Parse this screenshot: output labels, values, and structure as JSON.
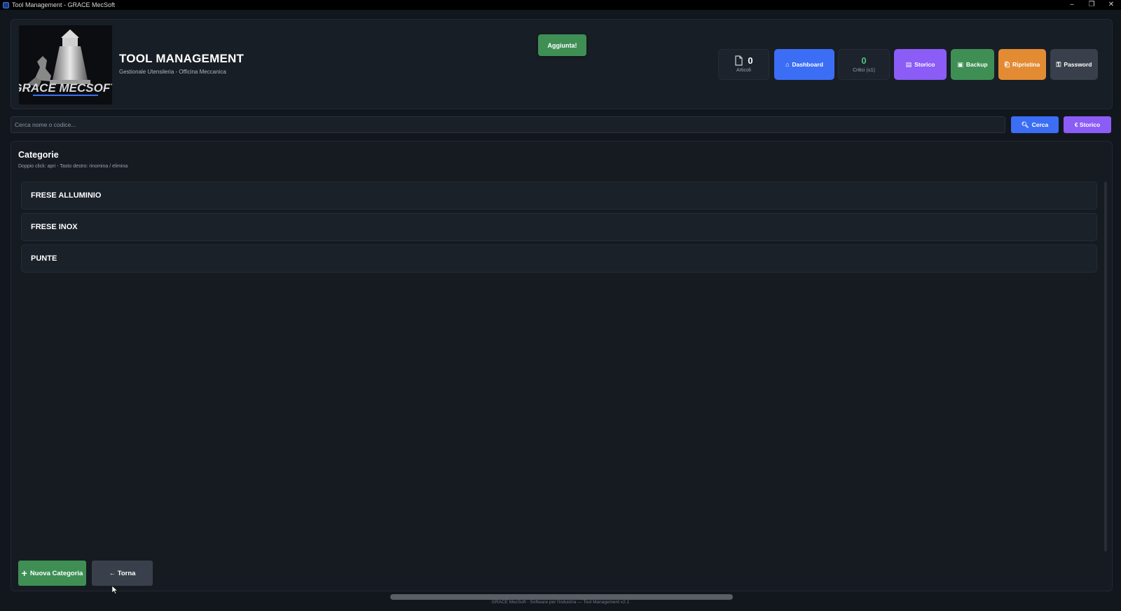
{
  "window": {
    "title": "Tool Management - GRACE MecSoft",
    "controls": [
      "–",
      "❐",
      "✕"
    ]
  },
  "header": {
    "logo_text": "GRACE MECSOFT",
    "title": "TOOL MANAGEMENT",
    "subtitle": "Gestionale Utensileria - Officina Meccanica",
    "toast": "Aggiunta!",
    "stats": {
      "articoli_value": "0",
      "articoli_label": "Articoli",
      "critici_value": "0",
      "critici_label": "Critici (≤1)"
    },
    "buttons": {
      "dashboard": "Dashboard",
      "storico": "Storico",
      "backup": "Backup",
      "ripristina": "Ripristina",
      "password": "Password"
    }
  },
  "search": {
    "placeholder": "Cerca nome o codice...",
    "cerca_label": "Cerca",
    "storico_label": "€ Storico"
  },
  "categories": {
    "title": "Categorie",
    "hint": "Doppio click: apri - Tasto destro: rinomina / elimina",
    "items": [
      "FRESE ALLUMINIO",
      "FRESE INOX",
      "PUNTE"
    ],
    "nuova_label": "Nuova Categoria",
    "torna_label": "← Torna"
  },
  "footer": "GRACE MecSoft - Software per l'industria — Tool Management v2.1",
  "colors": {
    "blue": "#3b6ef5",
    "purple": "#8b5cf6",
    "green": "#3f8f55",
    "orange": "#e38b33",
    "grey": "#3a404b"
  }
}
